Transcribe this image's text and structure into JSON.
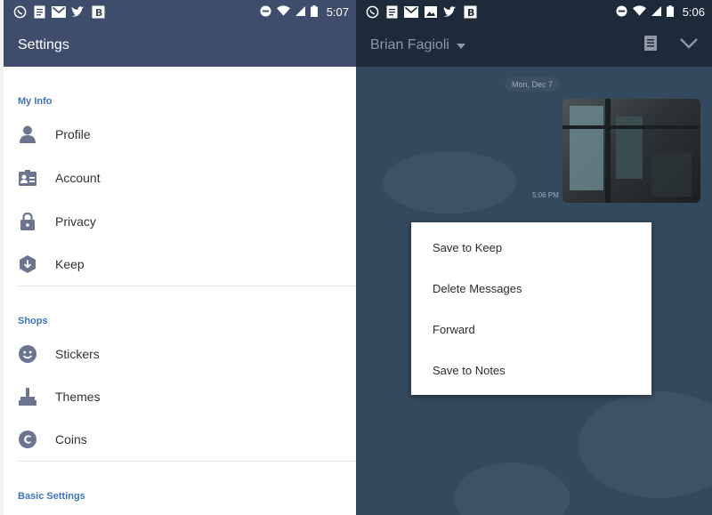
{
  "left_screen": {
    "status_bar": {
      "notification_icons": [
        "whatsapp-icon",
        "docs-icon",
        "gmail-icon",
        "twitter-icon",
        "b-app-icon"
      ],
      "time": "5:07"
    },
    "app_bar": {
      "title": "Settings"
    },
    "sections": [
      {
        "header": "My Info",
        "items": [
          {
            "label": "Profile",
            "icon": "person-icon"
          },
          {
            "label": "Account",
            "icon": "id-card-icon"
          },
          {
            "label": "Privacy",
            "icon": "lock-icon"
          },
          {
            "label": "Keep",
            "icon": "keep-download-icon"
          }
        ]
      },
      {
        "header": "Shops",
        "items": [
          {
            "label": "Stickers",
            "icon": "smiley-icon"
          },
          {
            "label": "Themes",
            "icon": "paint-brush-icon"
          },
          {
            "label": "Coins",
            "icon": "coin-icon"
          }
        ]
      },
      {
        "header": "Basic Settings",
        "items": []
      }
    ],
    "colors": {
      "header_bg": "#3f4d6d",
      "section_header": "#3f74c4",
      "icon": "#6b7590"
    }
  },
  "right_screen": {
    "status_bar": {
      "notification_icons": [
        "whatsapp-icon",
        "docs-icon",
        "gmail-icon",
        "image-icon",
        "twitter-icon",
        "b-app-icon"
      ],
      "time": "5:06"
    },
    "app_bar": {
      "contact_name": "Brian Fagioli",
      "actions": [
        "notes-icon",
        "chevron-down-icon"
      ]
    },
    "chat": {
      "date_label": "Mon, Dec 7",
      "message_time": "5:06 PM"
    },
    "context_menu": {
      "items": [
        "Save to Keep",
        "Delete Messages",
        "Forward",
        "Save to Notes"
      ]
    },
    "colors": {
      "chat_bg": "#33495e",
      "app_bar_bg": "#1c2a3a"
    }
  }
}
